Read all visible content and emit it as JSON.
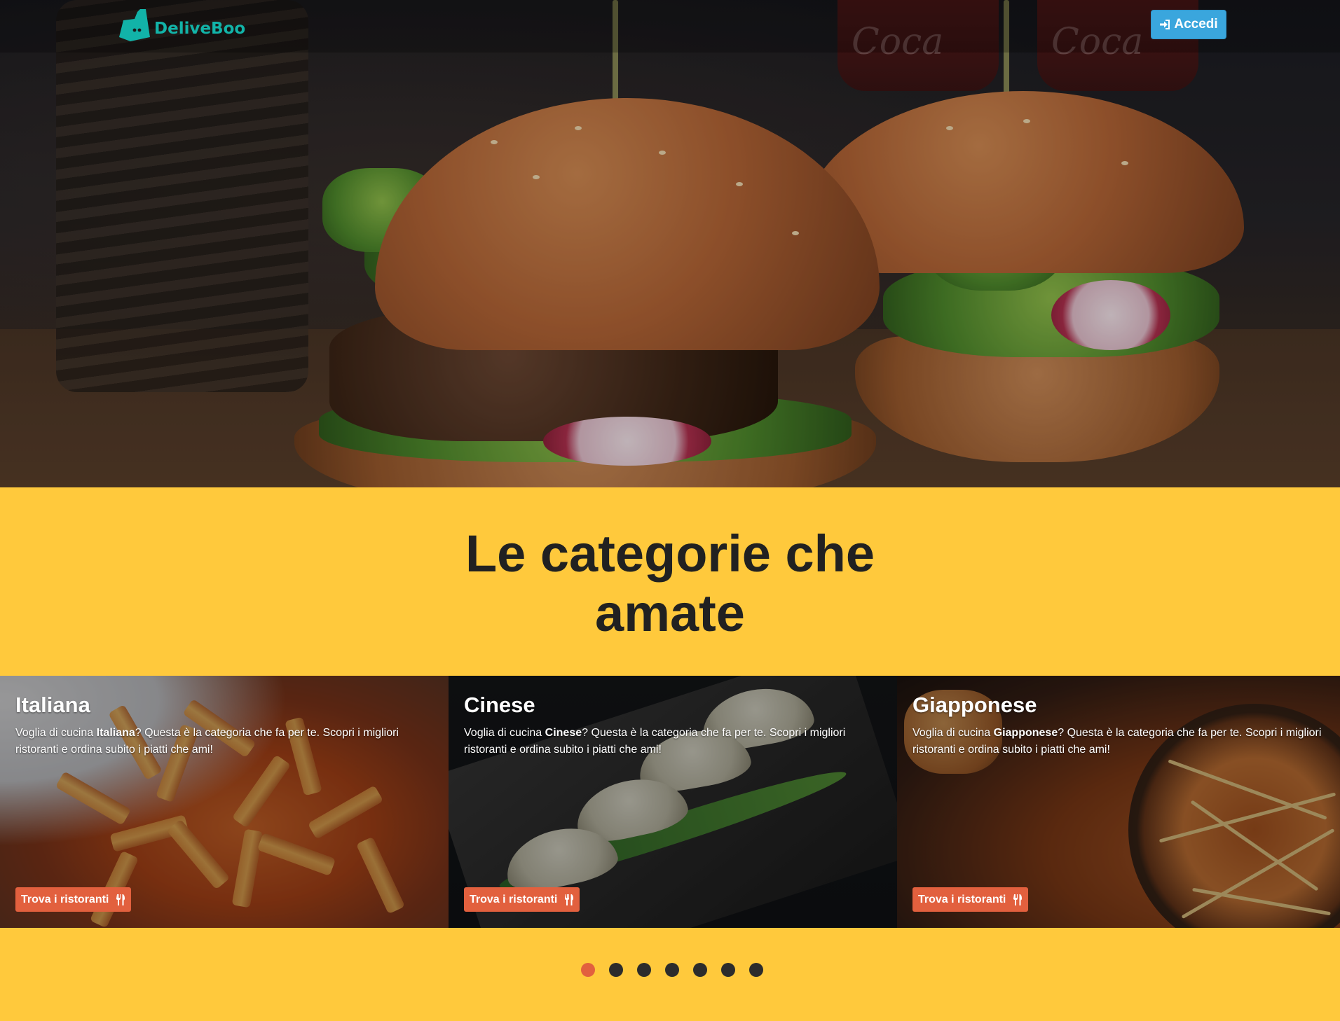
{
  "navbar": {
    "logo_text": "DeliveBoo",
    "login_label": "Accedi",
    "icons": {
      "logo": "deliveroo-kangaroo-icon",
      "login": "sign-in-icon"
    }
  },
  "section": {
    "title_line1": "Le categorie che",
    "title_line2": "amate"
  },
  "categories": [
    {
      "name": "Italiana",
      "text_before": "Voglia di cucina ",
      "text_bold": "Italiana",
      "text_after": "? Questa è la categoria che fa per te. Scopri i migliori ristoranti e ordina subito i piatti che ami!",
      "button_label": "Trova i ristoranti"
    },
    {
      "name": "Cinese",
      "text_before": "Voglia di cucina ",
      "text_bold": "Cinese",
      "text_after": "? Questa è la categoria che fa per te. Scopri i migliori ristoranti e ordina subito i piatti che ami!",
      "button_label": "Trova i ristoranti"
    },
    {
      "name": "Giapponese",
      "text_before": "Voglia di cucina ",
      "text_bold": "Giapponese",
      "text_after": "? Questa è la categoria che fa per te. Scopri i migliori ristoranti e ordina subito i piatti che ami!",
      "button_label": "Trova i ristoranti"
    }
  ],
  "carousel": {
    "dot_count": 7,
    "active_index": 0
  },
  "colors": {
    "background": "#ffc93c",
    "accent_button": "#e2603e",
    "login_button": "#3aa6dd",
    "logo": "#12b3a8",
    "title": "#212121"
  }
}
